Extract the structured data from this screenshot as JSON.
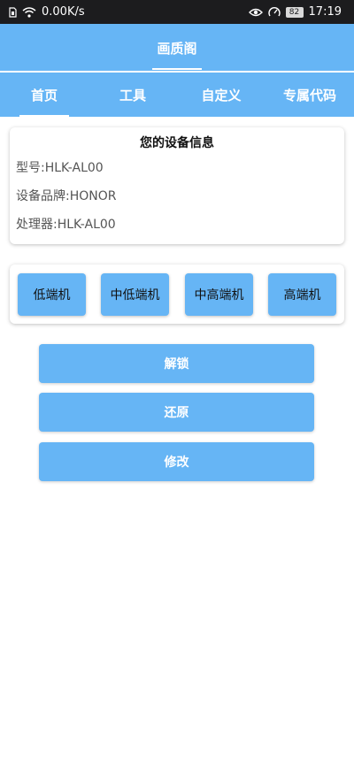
{
  "status_bar": {
    "speed": "0.00K/s",
    "battery": "82",
    "time": "17:19",
    "icons": [
      "sim-icon",
      "wifi-icon",
      "eye-icon",
      "speedometer-icon",
      "battery-icon"
    ]
  },
  "app": {
    "title": "画质阁"
  },
  "tabs": [
    {
      "label": "首页",
      "active": true
    },
    {
      "label": "工具",
      "active": false
    },
    {
      "label": "自定义",
      "active": false
    },
    {
      "label": "专属代码",
      "active": false
    }
  ],
  "device_info": {
    "heading": "您的设备信息",
    "model": "型号:HLK-AL00",
    "brand": "设备品牌:HONOR",
    "processor": "处理器:HLK-AL00"
  },
  "device_tiers": [
    "低端机",
    "中低端机",
    "中高端机",
    "高端机"
  ],
  "actions": {
    "unlock": "解锁",
    "restore": "还原",
    "modify": "修改"
  },
  "colors": {
    "accent": "#66b5f5",
    "status_bar": "#1c1c1e",
    "background": "#ffffff"
  }
}
